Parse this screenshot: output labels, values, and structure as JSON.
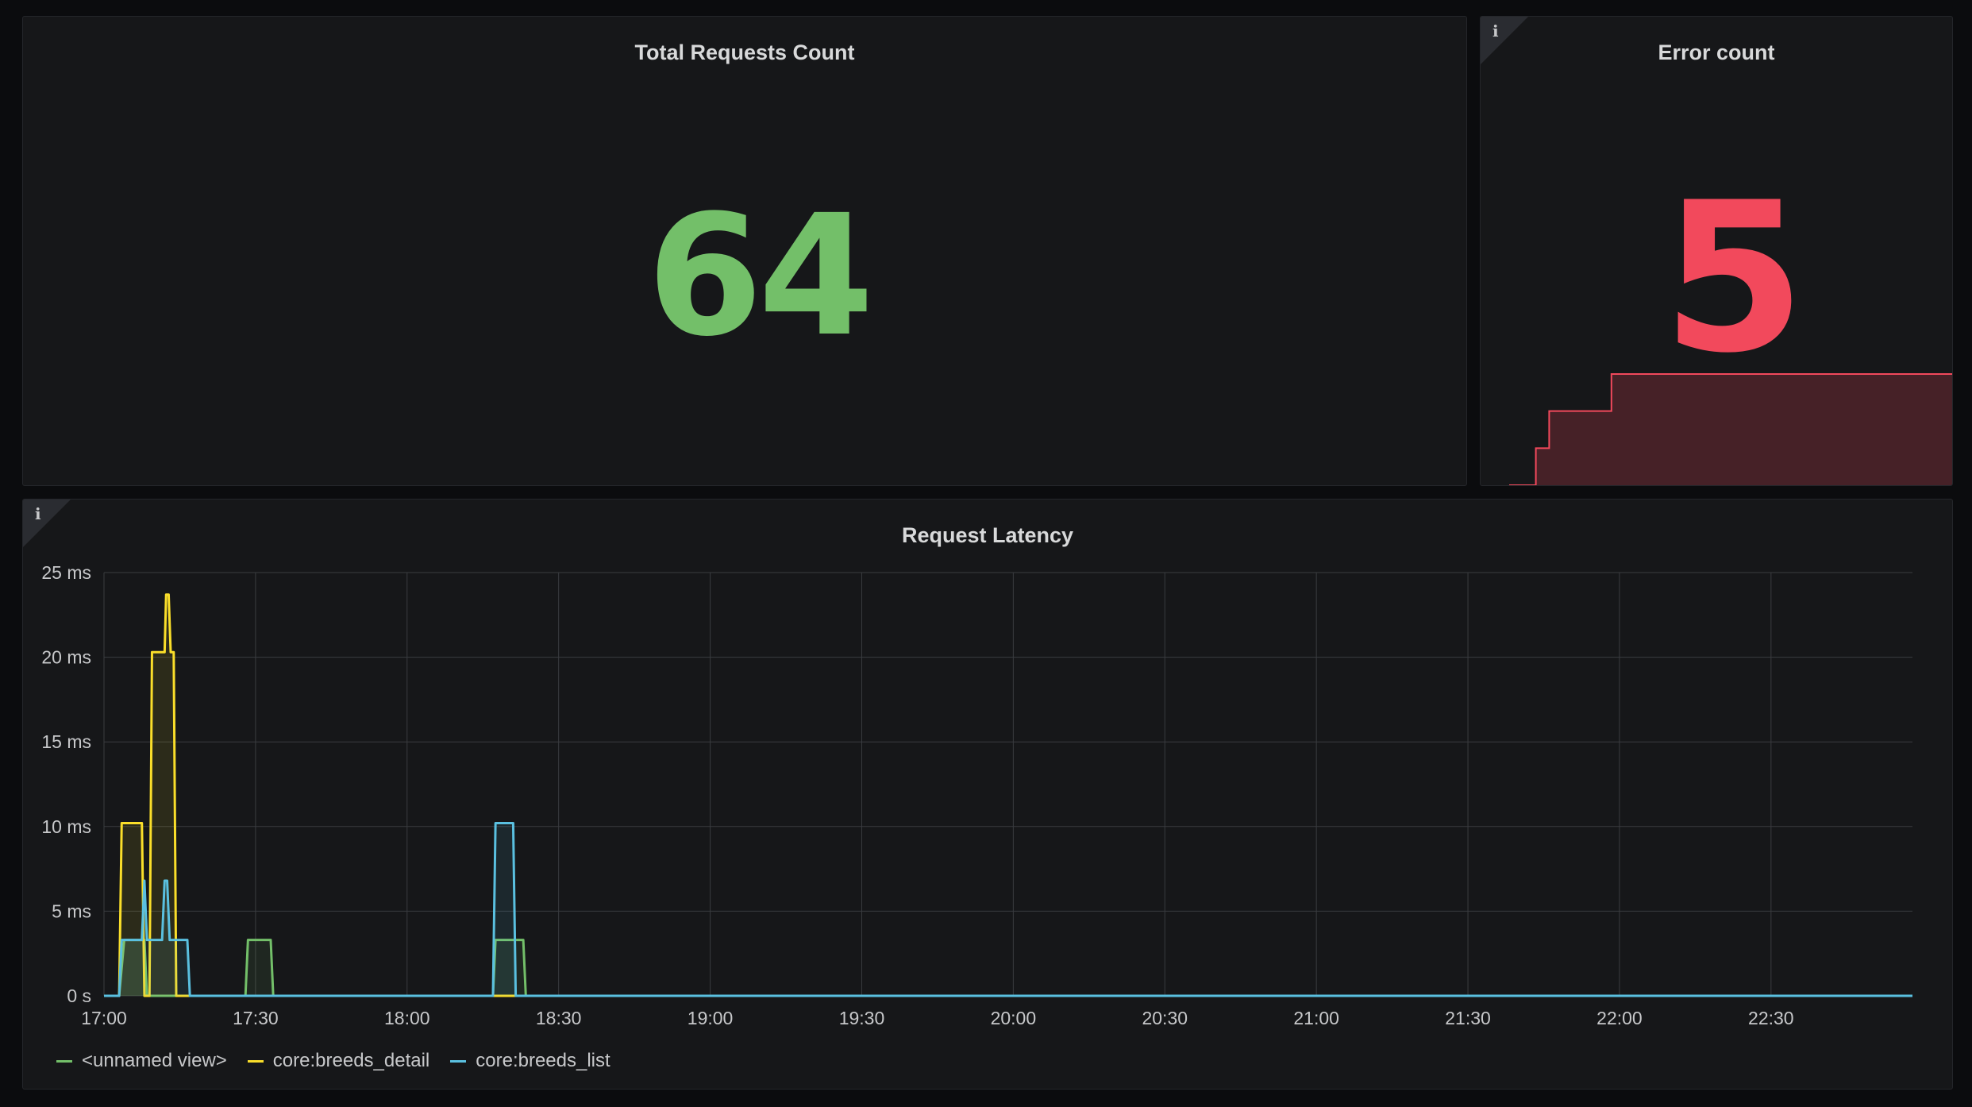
{
  "panels": {
    "total": {
      "title": "Total Requests Count",
      "value": "64",
      "color": "#73bf69"
    },
    "error": {
      "title": "Error count",
      "value": "5",
      "color": "#f2495c",
      "info_icon": "i",
      "sparkline": {
        "x_range": [
          "17:00",
          "23:00"
        ],
        "points": [
          [
            0,
            0
          ],
          [
            0.06,
            1
          ],
          [
            0.08,
            1
          ],
          [
            0.09,
            2
          ],
          [
            0.22,
            2
          ],
          [
            0.23,
            3
          ],
          [
            1,
            3
          ]
        ],
        "ymax": 3
      }
    },
    "latency": {
      "title": "Request Latency",
      "info_icon": "i"
    }
  },
  "chart_data": {
    "type": "line",
    "title": "Request Latency",
    "y_unit": "ms",
    "ylim": [
      0,
      25
    ],
    "y_ticks": [
      "0 s",
      "5 ms",
      "10 ms",
      "15 ms",
      "20 ms",
      "25 ms"
    ],
    "x_range_minutes": [
      0,
      358
    ],
    "x_ticks": [
      "17:00",
      "17:30",
      "18:00",
      "18:30",
      "19:00",
      "19:30",
      "20:00",
      "20:30",
      "21:00",
      "21:30",
      "22:00",
      "22:30"
    ],
    "grid": true,
    "legend_position": "bottom-left",
    "series": [
      {
        "name": "<unnamed view>",
        "color": "#73bf69",
        "points": [
          [
            0,
            0
          ],
          [
            3,
            0
          ],
          [
            4,
            3.3
          ],
          [
            8,
            3.3
          ],
          [
            8.5,
            0
          ],
          [
            28,
            0
          ],
          [
            28.5,
            3.3
          ],
          [
            33,
            3.3
          ],
          [
            33.5,
            0
          ],
          [
            77,
            0
          ],
          [
            77.5,
            3.3
          ],
          [
            83,
            3.3
          ],
          [
            83.5,
            0
          ],
          [
            358,
            0
          ]
        ]
      },
      {
        "name": "core:breeds_detail",
        "color": "#fade2a",
        "points": [
          [
            0,
            0
          ],
          [
            3,
            0
          ],
          [
            3.5,
            10.2
          ],
          [
            7.5,
            10.2
          ],
          [
            8,
            0
          ],
          [
            9,
            0
          ],
          [
            9.5,
            20.3
          ],
          [
            12,
            20.3
          ],
          [
            12.3,
            23.7
          ],
          [
            12.8,
            23.7
          ],
          [
            13.2,
            20.3
          ],
          [
            13.8,
            20.3
          ],
          [
            14.3,
            0
          ],
          [
            358,
            0
          ]
        ]
      },
      {
        "name": "core:breeds_list",
        "color": "#5ac0e0",
        "points": [
          [
            0,
            0
          ],
          [
            3,
            0
          ],
          [
            3.5,
            3.3
          ],
          [
            7.5,
            3.3
          ],
          [
            8,
            6.8
          ],
          [
            8.5,
            3.3
          ],
          [
            11.5,
            3.3
          ],
          [
            12,
            6.8
          ],
          [
            12.5,
            6.8
          ],
          [
            13,
            3.3
          ],
          [
            16.5,
            3.3
          ],
          [
            17,
            0
          ],
          [
            77,
            0
          ],
          [
            77.5,
            10.2
          ],
          [
            81,
            10.2
          ],
          [
            81.5,
            0
          ],
          [
            358,
            0
          ]
        ]
      }
    ]
  }
}
